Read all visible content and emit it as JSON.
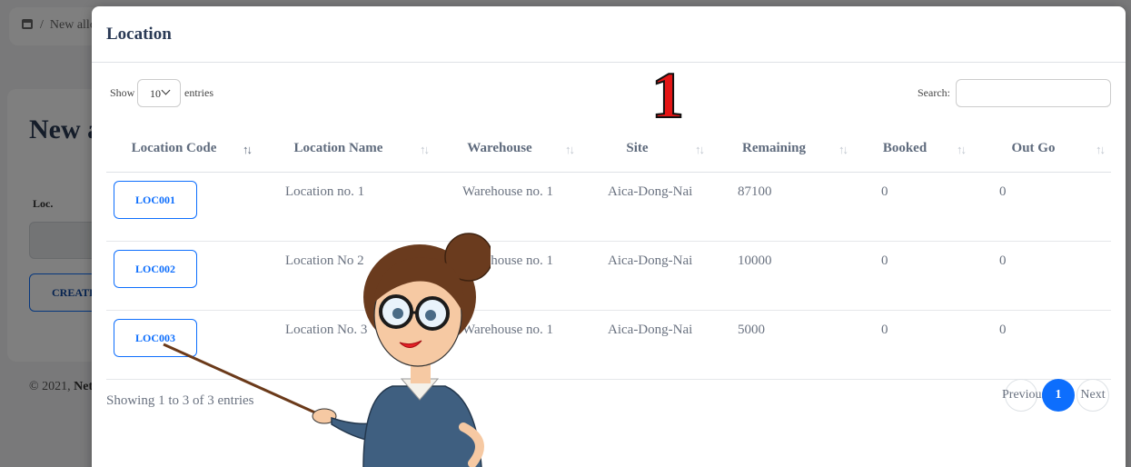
{
  "background": {
    "breadcrumb": "New allo",
    "card_title": "New a",
    "loc_label": "Loc.",
    "create_label": "CREATE",
    "footer_prefix": "© 2021,",
    "footer_brand": "Net"
  },
  "modal": {
    "title": "Location",
    "show_label": "Show",
    "entries_value": "10",
    "entries_label": "entries",
    "search_label": "Search:",
    "search_value": "",
    "annotation": "1",
    "columns": [
      "Location Code",
      "Location Name",
      "Warehouse",
      "Site",
      "Remaining",
      "Booked",
      "Out Go"
    ],
    "rows": [
      {
        "code": "LOC001",
        "name": "Location no. 1",
        "warehouse": "Warehouse no. 1",
        "site": "Aica-Dong-Nai",
        "remaining": "87100",
        "booked": "0",
        "outgo": "0"
      },
      {
        "code": "LOC002",
        "name": "Location No 2",
        "warehouse": "Warehouse no. 1",
        "site": "Aica-Dong-Nai",
        "remaining": "10000",
        "booked": "0",
        "outgo": "0"
      },
      {
        "code": "LOC003",
        "name": "Location No. 3",
        "warehouse": "Warehouse no. 1",
        "site": "Aica-Dong-Nai",
        "remaining": "5000",
        "booked": "0",
        "outgo": "0"
      }
    ],
    "info": "Showing 1 to 3 of 3 entries",
    "pagination": {
      "previous": "Previous",
      "current": "1",
      "next": "Next"
    }
  },
  "colors": {
    "primary": "#0d6efd",
    "annotation": "#e41515",
    "title": "#2a3a55"
  }
}
